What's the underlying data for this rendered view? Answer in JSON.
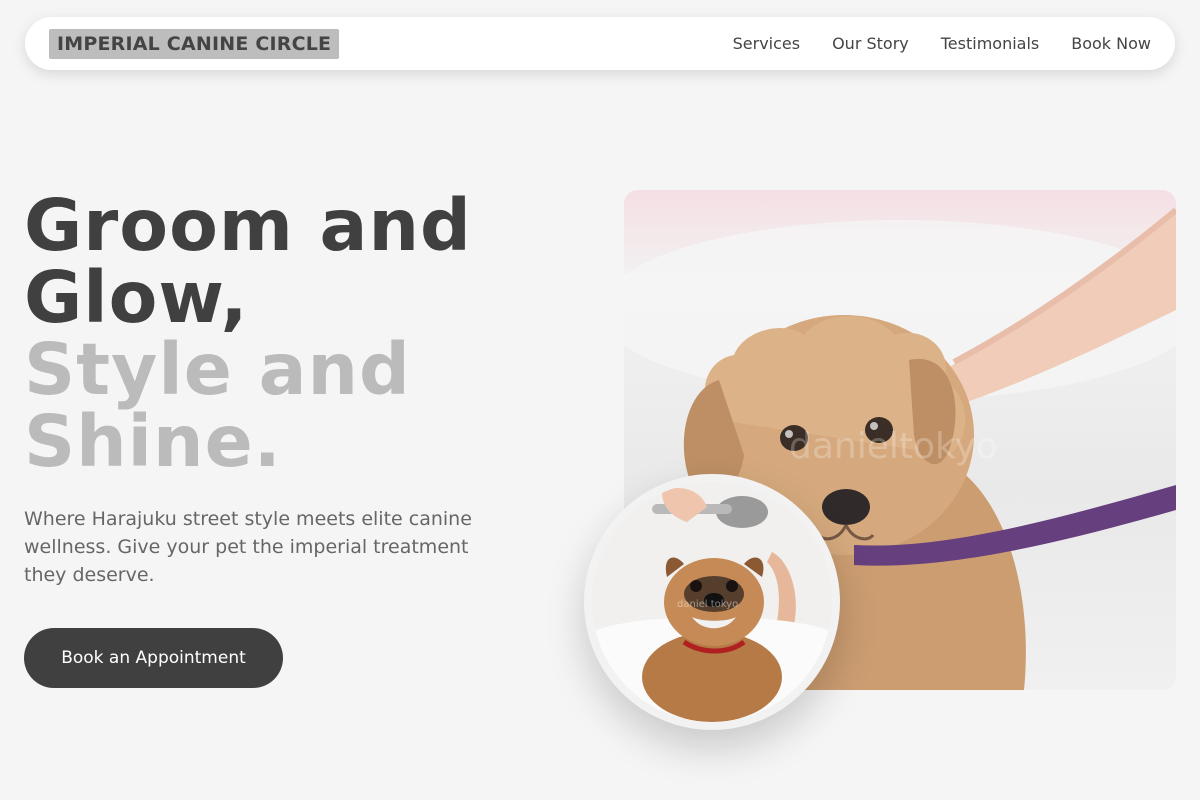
{
  "brand": "IMPERIAL CANINE CIRCLE",
  "nav": [
    "Services",
    "Our Story",
    "Testimonials",
    "Book Now"
  ],
  "hero": {
    "title_line1": "Groom and Glow,",
    "title_line2": "Style and Shine.",
    "subtitle": "Where Harajuku street style meets elite canine wellness. Give your pet the imperial treatment they deserve.",
    "cta": "Book an Appointment"
  },
  "images": {
    "main_alt": "wet terrier puppy on purple leash",
    "main_watermark": "danieltokyo",
    "circle_alt": "french bulldog being bathed",
    "circle_watermark": "daniel tokyo"
  },
  "colors": {
    "background": "#f5f5f5",
    "dark": "#404040",
    "muted": "#bbbbbb",
    "leash": "#5a2f73"
  }
}
